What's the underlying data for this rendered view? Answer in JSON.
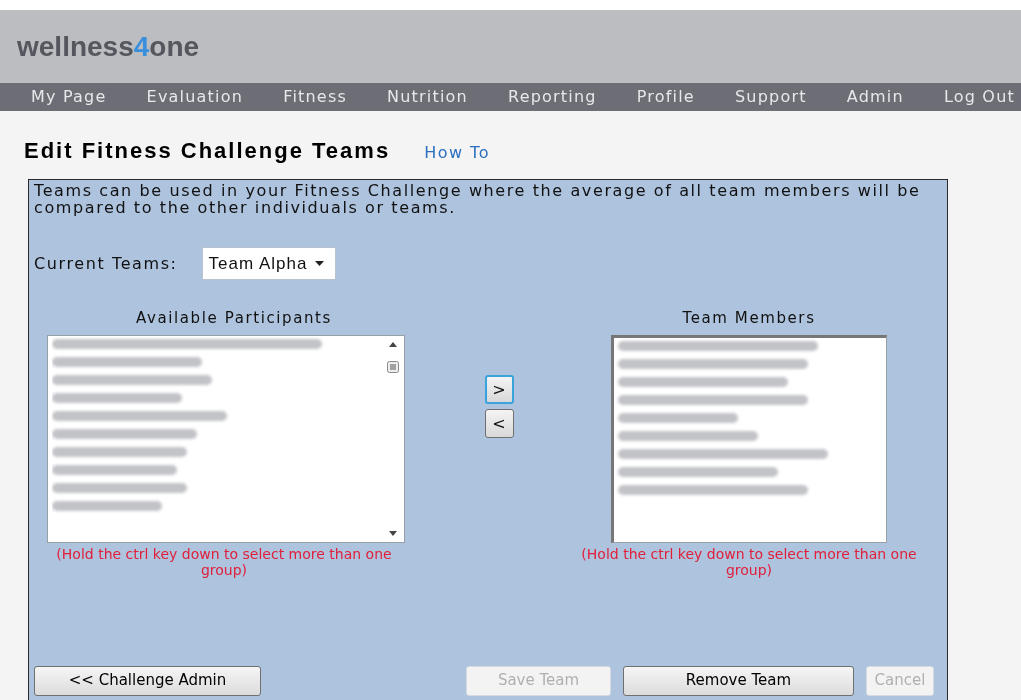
{
  "header": {
    "logo_prefix": "wellness",
    "logo_digit": "4",
    "logo_suffix": "one"
  },
  "nav": [
    "My Page",
    "Evaluation",
    "Fitness",
    "Nutrition",
    "Reporting",
    "Profile",
    "Support",
    "Admin",
    "Log Out"
  ],
  "page": {
    "title": "Edit Fitness Challenge Teams",
    "help_link": "How To"
  },
  "intro": "Teams can be used in your Fitness Challenge where the average of all team members will be compared to the other individuals or teams.",
  "current_teams": {
    "label": "Current Teams:",
    "value": "Team Alpha"
  },
  "available": {
    "heading": "Available Participants",
    "entries": [
      {
        "kind": "redacted"
      },
      {
        "kind": "redacted"
      },
      {
        "kind": "redacted"
      },
      {
        "kind": "redacted"
      },
      {
        "kind": "redacted"
      },
      {
        "kind": "redacted"
      },
      {
        "kind": "redacted"
      },
      {
        "kind": "redacted"
      },
      {
        "kind": "redacted"
      },
      {
        "kind": "redacted"
      }
    ],
    "hint": "(Hold the ctrl key down to select more than one group)"
  },
  "move_buttons": [
    {
      "label": ">",
      "focused": true
    },
    {
      "label": "<",
      "focused": false
    }
  ],
  "members": {
    "heading": "Team Members",
    "entries": [
      {
        "kind": "redacted"
      },
      {
        "kind": "redacted"
      },
      {
        "kind": "redacted"
      },
      {
        "kind": "redacted"
      },
      {
        "kind": "redacted"
      },
      {
        "kind": "redacted"
      },
      {
        "kind": "redacted"
      },
      {
        "kind": "redacted"
      },
      {
        "kind": "redacted"
      }
    ],
    "hint": "(Hold the ctrl key down to select more than one group)"
  },
  "back_button": {
    "label": "<< Challenge Admin",
    "disabled": false
  },
  "actions": [
    {
      "label": "Save Team",
      "disabled": true
    },
    {
      "label": "Remove Team",
      "disabled": false
    },
    {
      "label": "Cancel",
      "disabled": true
    }
  ]
}
